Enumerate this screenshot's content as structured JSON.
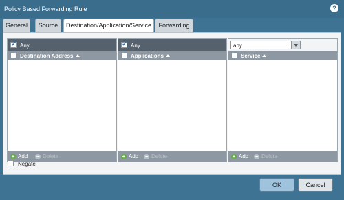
{
  "dialog": {
    "title": "Policy Based Forwarding Rule",
    "help_icon": "?"
  },
  "tabs": [
    {
      "label": "General",
      "active": false
    },
    {
      "label": "Source",
      "active": false
    },
    {
      "label": "Destination/Application/Service",
      "active": true
    },
    {
      "label": "Forwarding",
      "active": false
    }
  ],
  "destination": {
    "any_label": "Any",
    "any_checked": true,
    "column_header": "Destination Address",
    "add_label": "Add",
    "delete_label": "Delete"
  },
  "applications": {
    "any_label": "Any",
    "any_checked": true,
    "column_header": "Applications",
    "add_label": "Add",
    "delete_label": "Delete"
  },
  "service": {
    "dropdown_value": "any",
    "column_header": "Service",
    "add_label": "Add",
    "delete_label": "Delete"
  },
  "negate": {
    "label": "Negate",
    "checked": false
  },
  "buttons": {
    "ok": "OK",
    "cancel": "Cancel"
  }
}
